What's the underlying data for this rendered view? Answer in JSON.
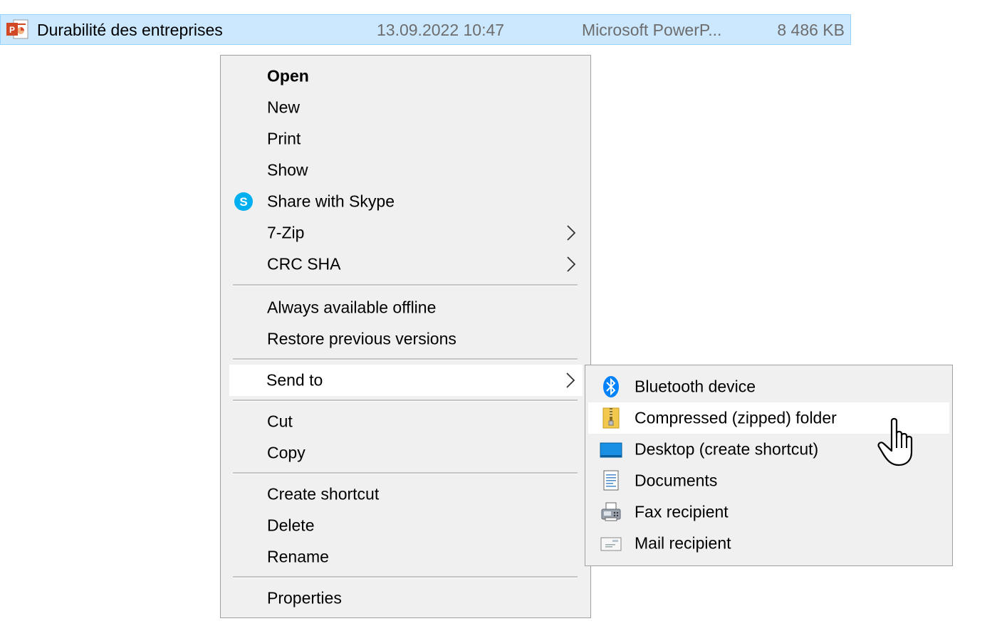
{
  "file": {
    "name": "Durabilité des entreprises",
    "date": "13.09.2022 10:47",
    "type": "Microsoft PowerP...",
    "size": "8 486 KB",
    "icon": "powerpoint-file-icon"
  },
  "context_menu": {
    "open": "Open",
    "new": "New",
    "print": "Print",
    "show": "Show",
    "share_skype": "Share with Skype",
    "seven_zip": "7-Zip",
    "crc_sha": "CRC SHA",
    "always_offline": "Always available offline",
    "restore_versions": "Restore previous versions",
    "send_to": "Send to",
    "cut": "Cut",
    "copy": "Copy",
    "create_shortcut": "Create shortcut",
    "delete": "Delete",
    "rename": "Rename",
    "properties": "Properties"
  },
  "send_to_menu": {
    "bluetooth": "Bluetooth device",
    "compressed": "Compressed (zipped) folder",
    "desktop": "Desktop (create shortcut)",
    "documents": "Documents",
    "fax": "Fax recipient",
    "mail": "Mail recipient"
  },
  "colors": {
    "selection_bg": "#cce8ff",
    "menu_bg": "#f0f0f0",
    "skype_blue": "#00aff0",
    "bluetooth_blue": "#0082fc"
  }
}
